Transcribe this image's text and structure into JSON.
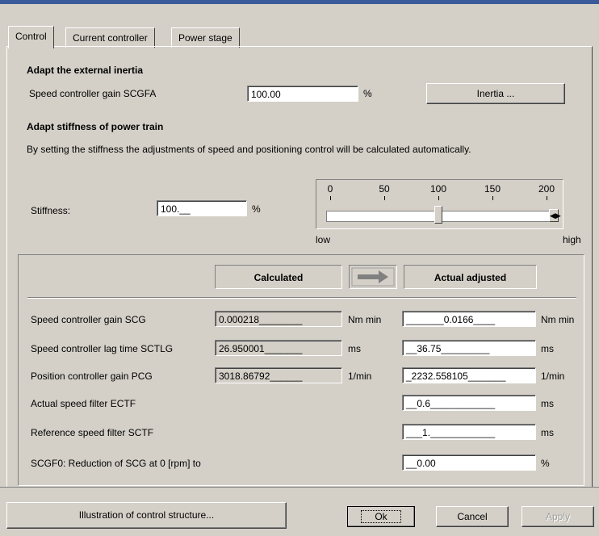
{
  "tabs": [
    {
      "label": "Control",
      "active": true
    },
    {
      "label": "Current controller",
      "active": false
    },
    {
      "label": "Power stage",
      "active": false
    }
  ],
  "inertia": {
    "heading": "Adapt the external inertia",
    "label": "Speed controller gain SCGFA",
    "value": "100.00",
    "unit": "%",
    "button": "Inertia ..."
  },
  "stiffness": {
    "heading": "Adapt stiffness of power train",
    "description": "By setting the stiffness the adjustments of speed and positioning control will be calculated automatically.",
    "label": "Stiffness:",
    "value": "100.__",
    "unit": "%",
    "slider": {
      "ticks": [
        "0",
        "50",
        "100",
        "150",
        "200"
      ],
      "low": "low",
      "high": "high",
      "value": 100
    }
  },
  "table": {
    "calculated_header": "Calculated",
    "actual_header": "Actual adjusted",
    "rows": [
      {
        "label": "Speed controller gain SCG",
        "calculated": "0.000218________",
        "calc_unit": "Nm min",
        "actual": "_______0.0166____",
        "actual_unit": "Nm min"
      },
      {
        "label": "Speed controller lag time SCTLG",
        "calculated": "26.950001_______",
        "calc_unit": "ms",
        "actual": "__36.75_________",
        "actual_unit": "ms"
      },
      {
        "label": "Position controller gain PCG",
        "calculated": "3018.86792______",
        "calc_unit": "1/min",
        "actual": "_2232.558105_______",
        "actual_unit": "1/min"
      },
      {
        "label": "Actual speed filter ECTF",
        "calculated": "",
        "calc_unit": "",
        "actual": "__0.6____________",
        "actual_unit": "ms"
      },
      {
        "label": "Reference speed filter SCTF",
        "calculated": "",
        "calc_unit": "",
        "actual": "___1.____________",
        "actual_unit": "ms"
      },
      {
        "label": "SCGF0: Reduction of SCG at 0 [rpm] to",
        "calculated": "",
        "calc_unit": "",
        "actual": "__0.00",
        "actual_unit": "%"
      }
    ]
  },
  "buttons": {
    "illustration": "Illustration of control structure...",
    "ok": "Ok",
    "cancel": "Cancel",
    "apply": "Apply"
  }
}
